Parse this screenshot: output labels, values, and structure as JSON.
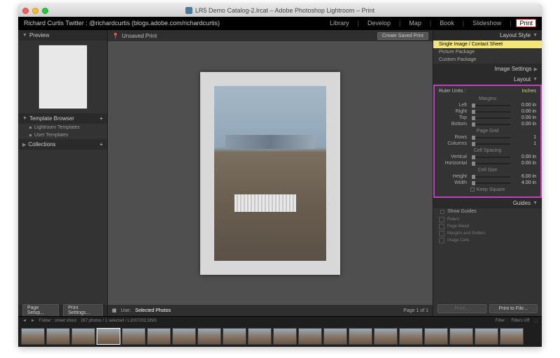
{
  "titlebar": {
    "title": "LR5 Demo Catalog-2.lrcat – Adobe Photoshop Lightroom – Print"
  },
  "id_line": "Richard Curtis Twitter : @richardcurtis (blogs.adobe.com/richardcurtis)",
  "modules": {
    "library": "Library",
    "develop": "Develop",
    "map": "Map",
    "book": "Book",
    "slideshow": "Slideshow",
    "print": "Print"
  },
  "left": {
    "preview": "Preview",
    "template_browser": "Template Browser",
    "templates": {
      "lightroom": "Lightroom Templates",
      "user": "User Templates"
    },
    "collections": "Collections"
  },
  "center": {
    "unsaved": "Unsaved Print",
    "create_saved": "Create Saved Print",
    "page_setup": "Page Setup...",
    "print_settings": "Print Settings...",
    "use": "Use:",
    "selected_photos": "Selected Photos",
    "page_info": "Page 1 of 1"
  },
  "right": {
    "layout_style": "Layout Style",
    "opts": {
      "single": "Single Image / Contact Sheet",
      "picture": "Picture Package",
      "custom": "Custom Package"
    },
    "image_settings": "Image Settings",
    "layout": "Layout",
    "ruler_units_lbl": "Ruler Units :",
    "ruler_units_val": "Inches",
    "margins": "Margins",
    "left_lbl": "Left",
    "right_lbl": "Right",
    "top_lbl": "Top",
    "bottom_lbl": "Bottom",
    "margin_val": "0.00 in",
    "page_grid": "Page Grid",
    "rows_lbl": "Rows",
    "cols_lbl": "Columns",
    "grid_val": "1",
    "cell_spacing": "Cell Spacing",
    "vert_lbl": "Vertical",
    "horiz_lbl": "Horizontal",
    "spacing_val": "0.00 in",
    "cell_size": "Cell Size",
    "height_lbl": "Height",
    "width_lbl": "Width",
    "height_val": "6.00 in",
    "width_val": "4.00 in",
    "keep_square": "Keep Square",
    "guides": "Guides",
    "show_guides": "Show Guides",
    "guide_items": {
      "rulers": "Rulers",
      "bleed": "Page Bleed",
      "margins": "Margins and Gutters",
      "cells": "Image Cells"
    },
    "print_btn": "Print...",
    "print_file_btn": "Print to File..."
  },
  "filmstrip": {
    "folder_lbl": "Folder : street shoot",
    "count": "287 photos / 1 selected / L1007202.DNG",
    "filter_lbl": "Filter :",
    "filters_off": "Filters Off"
  }
}
